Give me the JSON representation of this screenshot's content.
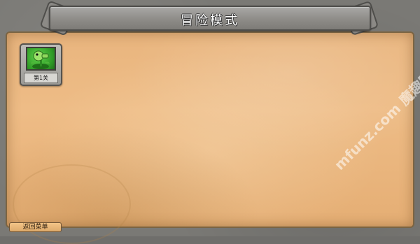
{
  "title": "冒险模式",
  "levels": [
    {
      "label": "第1关",
      "icon": "peashooter-icon"
    }
  ],
  "back_button": "返回菜单",
  "watermark": "mfunz.com 魔趣网",
  "colors": {
    "parchment": "#eebc86",
    "stone": "#7a7975",
    "thumb_green": "#2f9a26"
  }
}
